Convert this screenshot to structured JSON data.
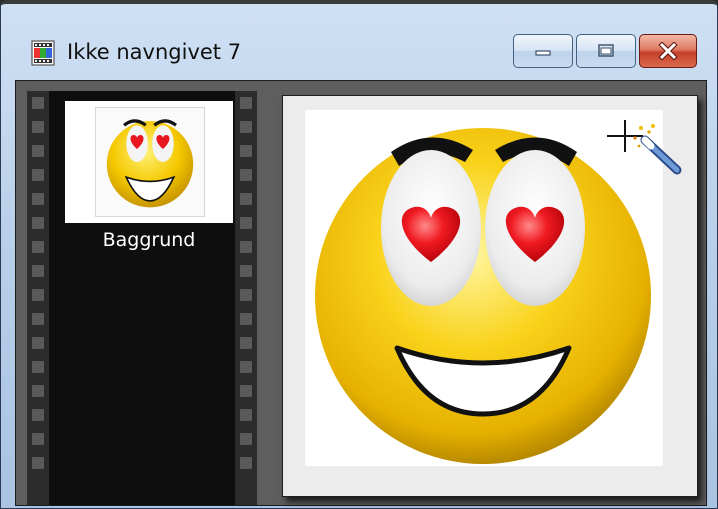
{
  "window": {
    "title": "Ikke navngivet 7",
    "icon": "film-document-icon"
  },
  "controls": {
    "minimize_icon": "minimize-icon",
    "maximize_icon": "maximize-icon",
    "close_icon": "close-icon"
  },
  "filmstrip": {
    "items": [
      {
        "label": "Baggrund"
      }
    ]
  },
  "canvas": {
    "cursor_icon": "magic-wand-cursor-icon",
    "image": "heart-eyes-smiley"
  },
  "colors": {
    "face": "#f5c800",
    "heart": "#e8161f",
    "close_button": "#c6402a"
  }
}
